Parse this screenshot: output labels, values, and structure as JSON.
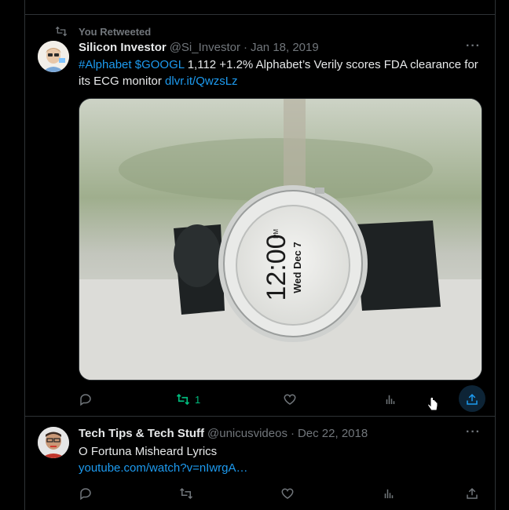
{
  "tweet1": {
    "retweet_label": "You Retweeted",
    "author_name": "Silicon Investor",
    "handle": "@Si_Investor",
    "dot": "·",
    "date": "Jan 18, 2019",
    "more": "···",
    "text_hashtag": "#Alphabet",
    "text_cashtag": "$GOOGL",
    "text_body": "1,112 +1.2% Alphabet’s Verily scores FDA clearance for its ECG monitor",
    "text_link": "dlvr.it/QwzsLz",
    "watch_time": "12:00",
    "watch_ampm": "PM",
    "watch_date": "Wed Dec 7",
    "retweet_count": "1",
    "retweet_active_color": "#00ba7c",
    "share_active_color": "#1d9bf0"
  },
  "tweet2": {
    "author_name": "Tech Tips & Tech Stuff",
    "handle": "@unicusvideos",
    "dot": "·",
    "date": "Dec 22, 2018",
    "more": "···",
    "text": "O Fortuna Misheard Lyrics",
    "link": "youtube.com/watch?v=nIwrgA…"
  },
  "icons": [
    "retweet-icon",
    "reply-icon",
    "like-icon",
    "views-icon",
    "share-icon",
    "more-icon",
    "cursor-icon"
  ]
}
